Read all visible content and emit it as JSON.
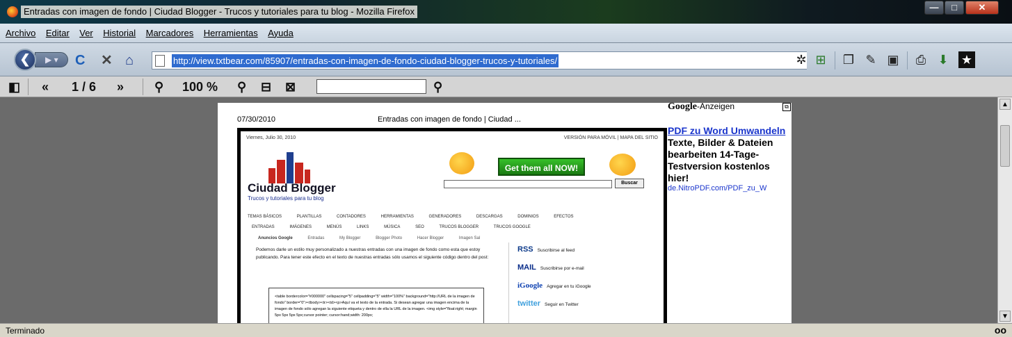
{
  "window": {
    "title": "Entradas con imagen de fondo | Ciudad Blogger - Trucos y tutoriales para tu blog - Mozilla Firefox",
    "min_glyph": "—",
    "max_glyph": "□",
    "close_glyph": "✕"
  },
  "menu": {
    "items": [
      "Archivo",
      "Editar",
      "Ver",
      "Historial",
      "Marcadores",
      "Herramientas",
      "Ayuda"
    ]
  },
  "nav": {
    "url": "http://view.txtbear.com/85907/entradas-con-imagen-de-fondo-ciudad-blogger-trucos-y-tutoriales/"
  },
  "reader": {
    "page_indicator": "1 / 6",
    "zoom": "100 %",
    "search_value": ""
  },
  "document": {
    "header_date": "07/30/2010",
    "header_title": "Entradas con imagen de fondo | Ciudad ...",
    "blog": {
      "date": "Viernes, Julio 30, 2010",
      "top_links": "VERSIÓN PARA MÓVIL | MAPA DEL SITIO",
      "name": "Ciudad Blogger",
      "tagline": "Trucos y tutoriales para tu blog",
      "banner": "Get them all NOW!",
      "search_button": "Buscar",
      "categories_row1": [
        "TEMAS BÁSICOS",
        "PLANTILLAS",
        "CONTADORES",
        "HERRAMIENTAS",
        "GENERADORES",
        "DESCARGAS",
        "DOMINIOS",
        "EFECTOS"
      ],
      "categories_row2": [
        "ENTRADAS",
        "IMÁGENES",
        "MENÚS",
        "LINKS",
        "MÚSICA",
        "SEO",
        "TRUCOS BLOGGER",
        "TRUCOS GOOGLE"
      ],
      "ads_label": "Anuncios Google",
      "ads_links": [
        "Entradas",
        "My Blogger",
        "Blogger Photo",
        "Hacer Blogger",
        "Imagen Sal"
      ],
      "post_text": "Podemos darle un estilo muy personalizado a nuestras entradas con una imagen de fondo como esta que estoy publicando. Para tener este efecto en el texto de nuestras entradas sólo usamos el siguiente código dentro del post:",
      "code_text": "<table bordercolor=\"#000000\" cellspacing=\"5\" cellpadding=\"5\" width=\"100%\" background=\"http://URL de la imagen de fondo\" border=\"0\"><tbody><tr><td><p>Aquí va el texto de la entrada. Si desean agregar una imagen encima de la imagen de fondo sólo agregan la siguiente etiqueta y dentro de ella la URL de la imagen. <img style=\"float:right; margin 5px 5px 5px 5px;cursor pointer; cursor:hand;width: 200px;",
      "feeds": [
        {
          "badge": "RSS",
          "label": "Suscribirse al feed"
        },
        {
          "badge": "MAIL",
          "label": "Suscribirse por e-mail"
        },
        {
          "badge": "iGoogle",
          "label": "Agregar en tu iGoogle"
        },
        {
          "badge": "twitter",
          "label": "Seguir en Twitter"
        }
      ]
    }
  },
  "ads": {
    "brand": "Google",
    "label": "-Anzeigen",
    "title": "PDF zu Word Umwandeln",
    "text": "Texte, Bilder & Dateien bearbeiten 14-Tage-Testversion kostenlos hier!",
    "url": "de.NitroPDF.com/PDF_zu_W"
  },
  "status": {
    "text": "Terminado",
    "icon": "oo"
  }
}
